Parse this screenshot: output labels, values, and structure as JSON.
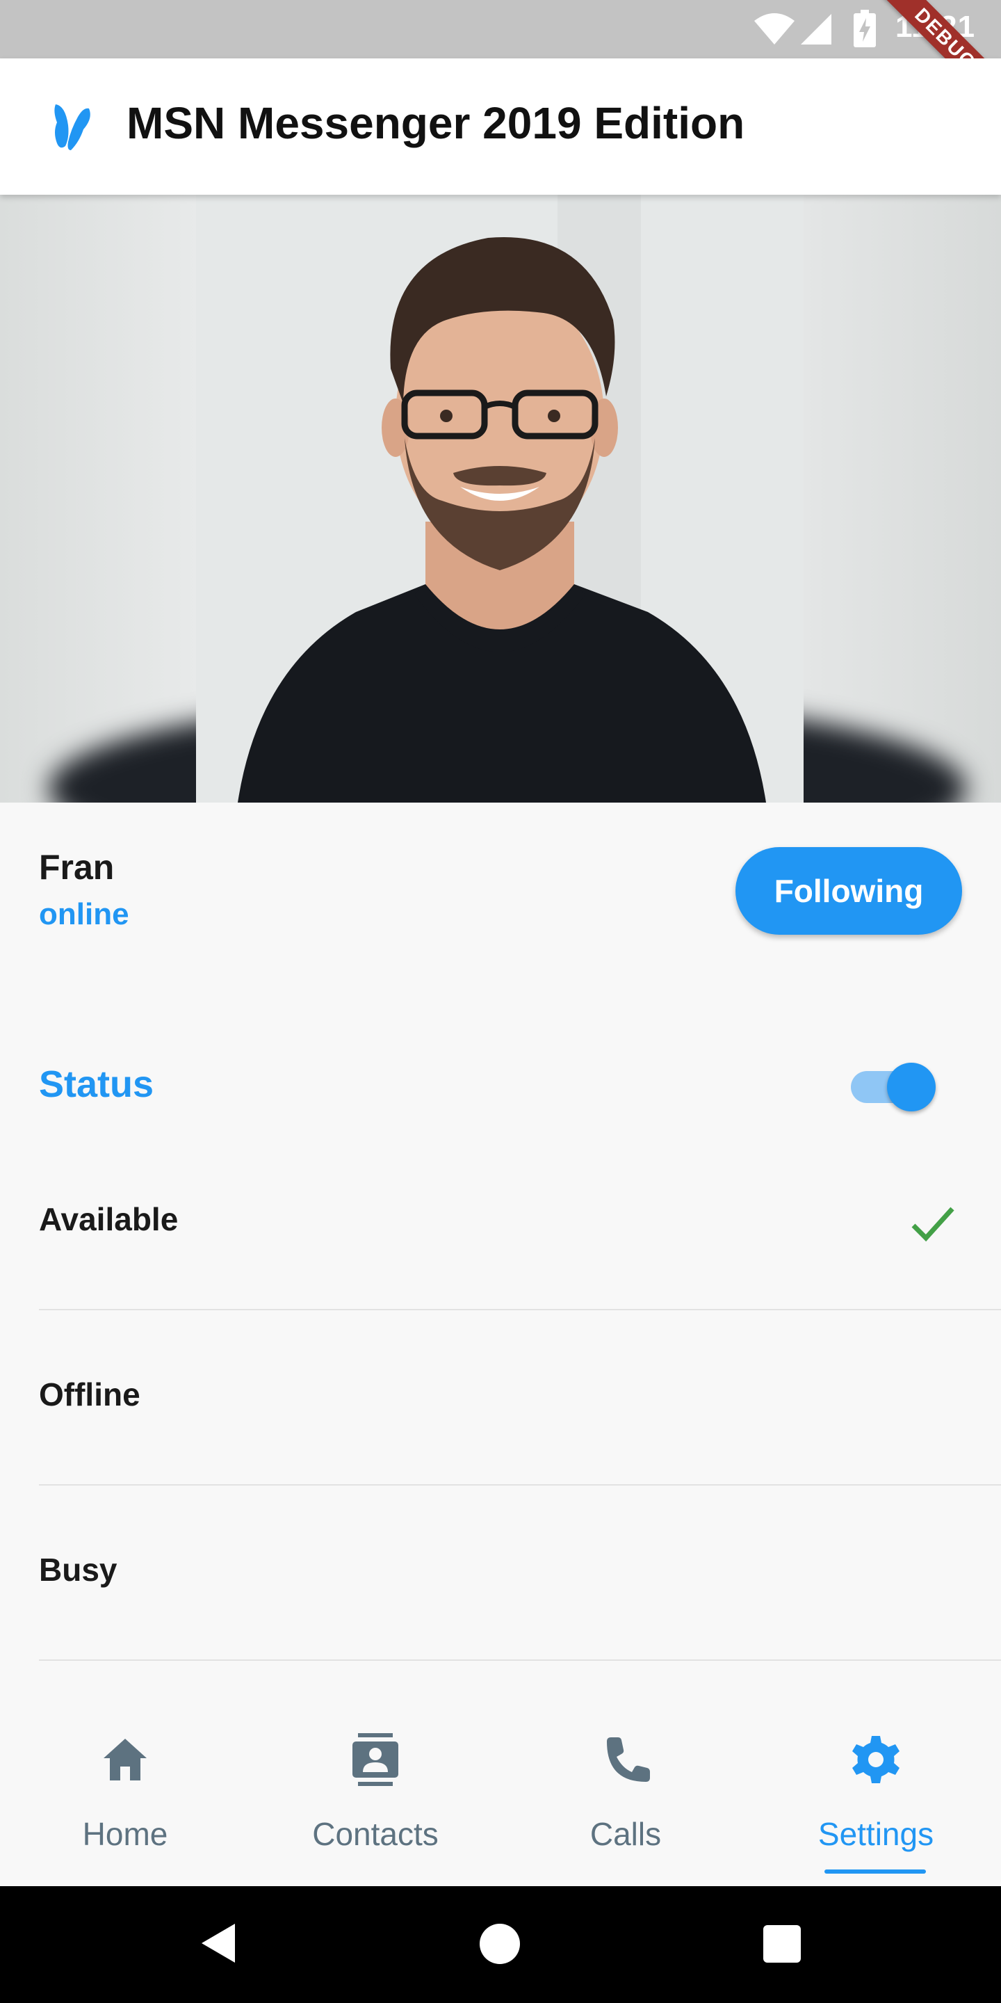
{
  "status_bar": {
    "time": "11:21",
    "debug_label": "DEBUG",
    "icons": [
      "wifi-icon",
      "signal-icon",
      "battery-charging-icon"
    ]
  },
  "app_bar": {
    "title": "MSN Messenger 2019 Edition",
    "logo_icon": "butterfly-logo-icon",
    "logo_color": "#2196f3"
  },
  "profile": {
    "name": "Fran",
    "presence": "online",
    "follow_label": "Following",
    "photo_icon": "profile-photo"
  },
  "status_section": {
    "heading": "Status",
    "toggle_on": true,
    "options": [
      {
        "label": "Available",
        "selected": true
      },
      {
        "label": "Offline",
        "selected": false
      },
      {
        "label": "Busy",
        "selected": false
      }
    ]
  },
  "bottom_nav": {
    "items": [
      {
        "label": "Home",
        "icon": "home-icon",
        "active": false
      },
      {
        "label": "Contacts",
        "icon": "contacts-icon",
        "active": false
      },
      {
        "label": "Calls",
        "icon": "phone-icon",
        "active": false
      },
      {
        "label": "Settings",
        "icon": "gear-icon",
        "active": true
      }
    ]
  },
  "colors": {
    "accent": "#2196f3",
    "check": "#43a047",
    "nav_inactive": "#5d7280",
    "background": "#f8f8f8"
  }
}
